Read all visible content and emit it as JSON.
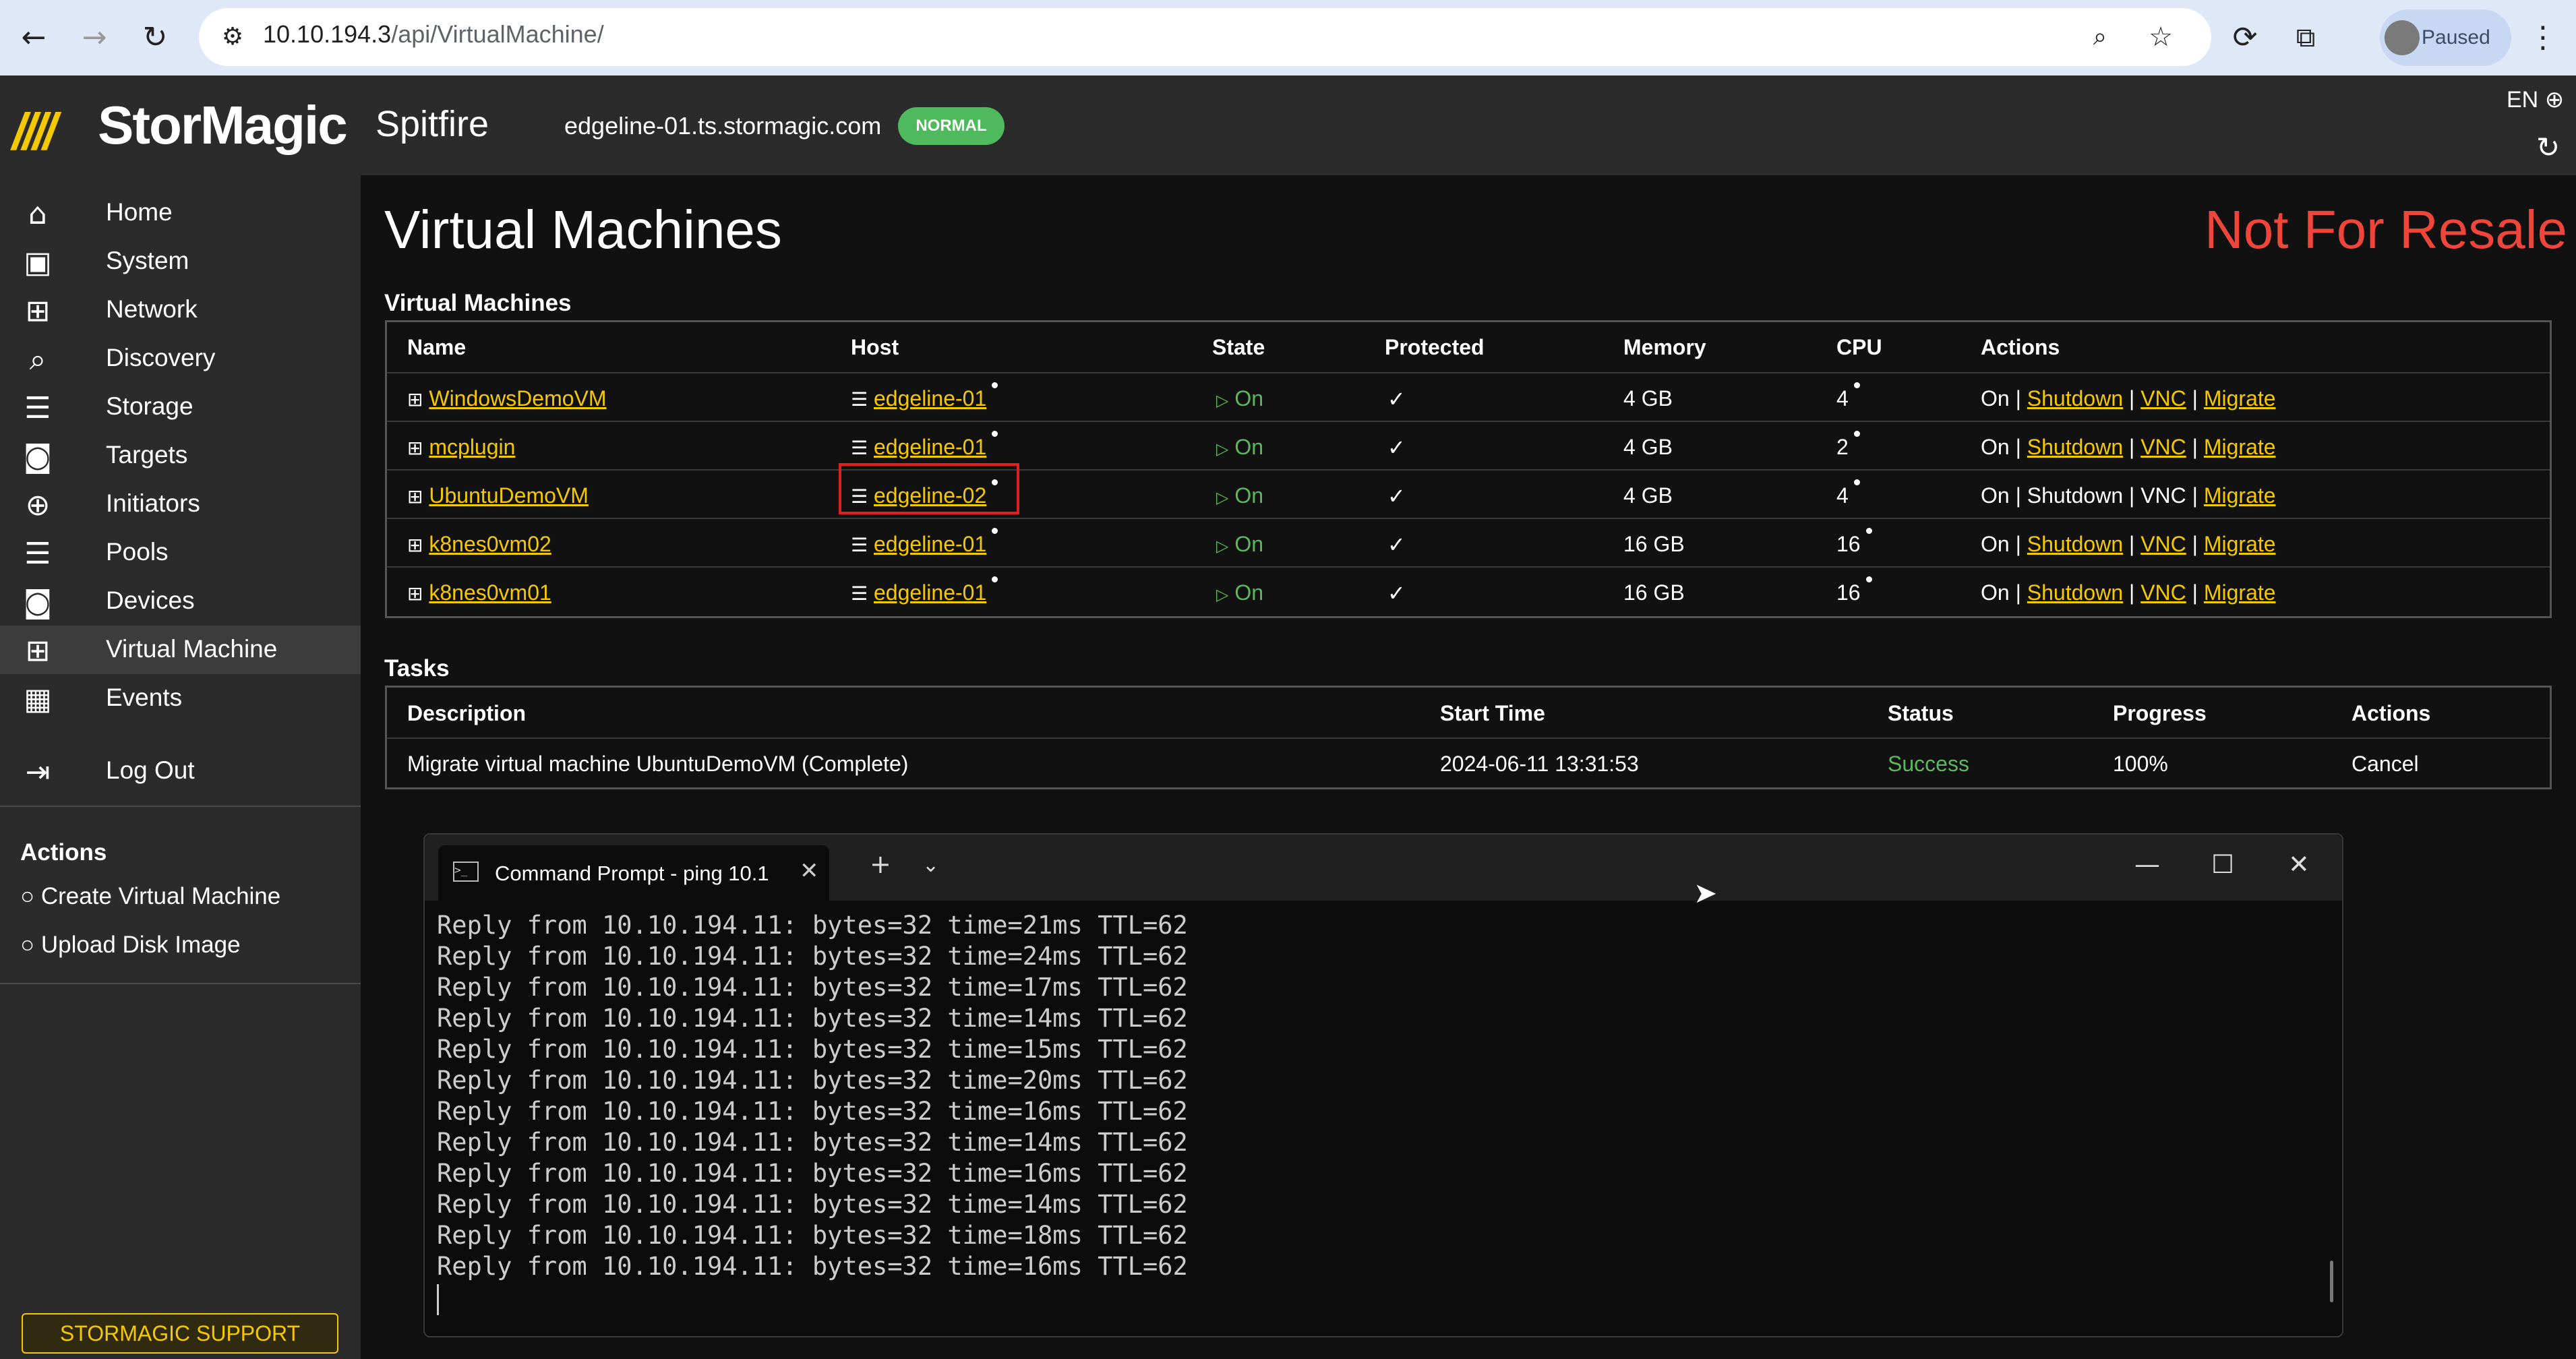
{
  "browser": {
    "url_host": "10.10.194.3",
    "url_path": "/api/VirtualMachine/",
    "profile_status": "Paused"
  },
  "header": {
    "logo": "StorMagic",
    "product": "Spitfire",
    "hostname": "edgeline-01.ts.stormagic.com",
    "status_badge": "NORMAL",
    "language": "EN"
  },
  "sidebar": {
    "items": [
      {
        "label": "Home",
        "icon": "home-icon"
      },
      {
        "label": "System",
        "icon": "system-icon"
      },
      {
        "label": "Network",
        "icon": "network-icon"
      },
      {
        "label": "Discovery",
        "icon": "discovery-icon"
      },
      {
        "label": "Storage",
        "icon": "storage-icon"
      },
      {
        "label": "Targets",
        "icon": "targets-icon"
      },
      {
        "label": "Initiators",
        "icon": "initiators-icon"
      },
      {
        "label": "Pools",
        "icon": "pools-icon"
      },
      {
        "label": "Devices",
        "icon": "devices-icon"
      },
      {
        "label": "Virtual Machine",
        "icon": "virtual-machine-icon"
      },
      {
        "label": "Events",
        "icon": "events-icon"
      },
      {
        "label": "Log Out",
        "icon": "logout-icon"
      }
    ],
    "actions_title": "Actions",
    "actions": [
      "Create Virtual Machine",
      "Upload Disk Image"
    ],
    "support_label": "STORMAGIC SUPPORT"
  },
  "page": {
    "title": "Virtual Machines",
    "watermark": "Not For Resale"
  },
  "vm_table": {
    "title": "Virtual Machines",
    "headers": [
      "Name",
      "Host",
      "State",
      "Protected",
      "Memory",
      "CPU",
      "Actions"
    ],
    "rows": [
      {
        "name": "WindowsDemoVM",
        "host": "edgeline-01",
        "state": "On",
        "protected": "✓",
        "memory": "4 GB",
        "cpu": "4",
        "act_on": "On",
        "act_shutdown": "Shutdown",
        "act_vnc": "VNC",
        "act_migrate": "Migrate",
        "sep": "|"
      },
      {
        "name": "mcplugin",
        "host": "edgeline-01",
        "state": "On",
        "protected": "✓",
        "memory": "4 GB",
        "cpu": "2",
        "act_on": "On",
        "act_shutdown": "Shutdown",
        "act_vnc": "VNC",
        "act_migrate": "Migrate",
        "sep": "|"
      },
      {
        "name": "UbuntuDemoVM",
        "host": "edgeline-02",
        "state": "On",
        "protected": "✓",
        "memory": "4 GB",
        "cpu": "4",
        "act_on": "On",
        "act_shutdown": "Shutdown",
        "act_vnc": "VNC",
        "act_migrate": "Migrate",
        "sep": "|"
      },
      {
        "name": "k8nes0vm02",
        "host": "edgeline-01",
        "state": "On",
        "protected": "✓",
        "memory": "16 GB",
        "cpu": "16",
        "act_on": "On",
        "act_shutdown": "Shutdown",
        "act_vnc": "VNC",
        "act_migrate": "Migrate",
        "sep": "|"
      },
      {
        "name": "k8nes0vm01",
        "host": "edgeline-01",
        "state": "On",
        "protected": "✓",
        "memory": "16 GB",
        "cpu": "16",
        "act_on": "On",
        "act_shutdown": "Shutdown",
        "act_vnc": "VNC",
        "act_migrate": "Migrate",
        "sep": "|"
      }
    ]
  },
  "tasks_table": {
    "title": "Tasks",
    "headers": [
      "Description",
      "Start Time",
      "Status",
      "Progress",
      "Actions"
    ],
    "rows": [
      {
        "description": "Migrate virtual machine UbuntuDemoVM (Complete)",
        "start_time": "2024-06-11 13:31:53",
        "status": "Success",
        "progress": "100%",
        "action": "Cancel"
      }
    ]
  },
  "terminal": {
    "tab_title": "Command Prompt - ping  10.1",
    "lines": [
      "Reply from 10.10.194.11: bytes=32 time=21ms TTL=62",
      "Reply from 10.10.194.11: bytes=32 time=24ms TTL=62",
      "Reply from 10.10.194.11: bytes=32 time=17ms TTL=62",
      "Reply from 10.10.194.11: bytes=32 time=14ms TTL=62",
      "Reply from 10.10.194.11: bytes=32 time=15ms TTL=62",
      "Reply from 10.10.194.11: bytes=32 time=20ms TTL=62",
      "Reply from 10.10.194.11: bytes=32 time=16ms TTL=62",
      "Reply from 10.10.194.11: bytes=32 time=14ms TTL=62",
      "Reply from 10.10.194.11: bytes=32 time=16ms TTL=62",
      "Reply from 10.10.194.11: bytes=32 time=14ms TTL=62",
      "Reply from 10.10.194.11: bytes=32 time=18ms TTL=62",
      "Reply from 10.10.194.11: bytes=32 time=16ms TTL=62"
    ]
  },
  "colors": {
    "accent": "#f4c900",
    "success": "#5cb85c",
    "watermark": "#f0453a",
    "badge": "#4fb95d"
  }
}
